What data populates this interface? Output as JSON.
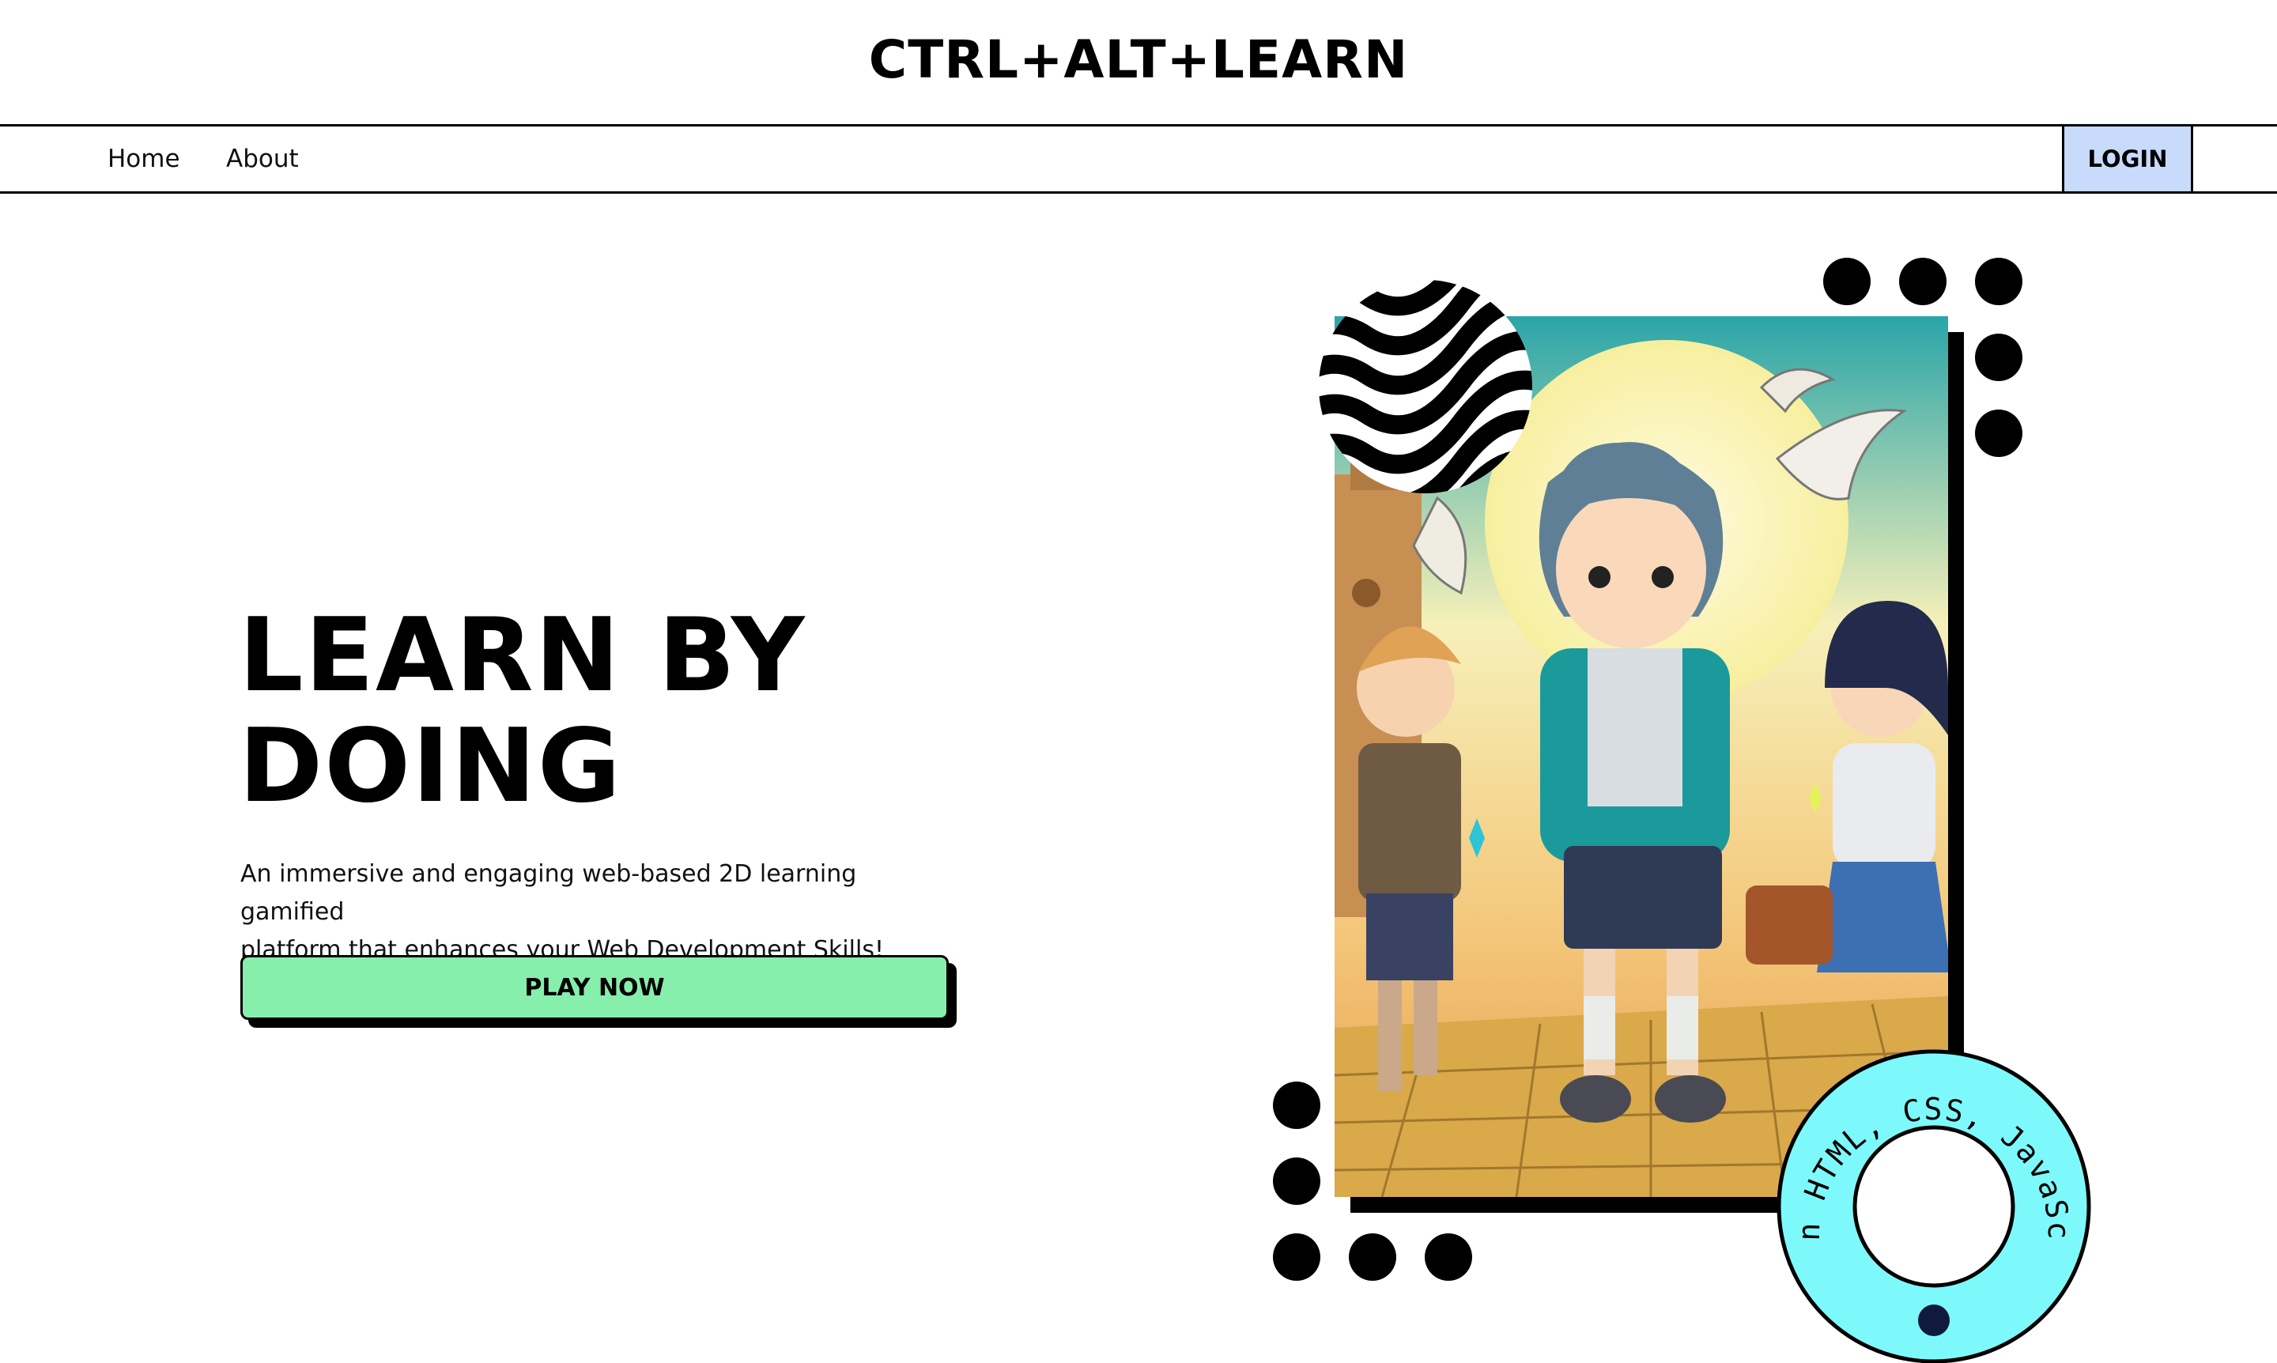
{
  "header": {
    "brand": "CTRL+ALT+LEARN"
  },
  "nav": {
    "home_label": "Home",
    "about_label": "About",
    "login_label": "LOGIN"
  },
  "hero": {
    "title_line1": "LEARN BY",
    "title_line2": "DOING",
    "description_line1": "An immersive and engaging web-based 2D learning gamified",
    "description_line2": "platform that enhances your Web Development Skills!",
    "cta_label": "PLAY NOW"
  },
  "badge": {
    "text": "Learn HTML, CSS, JavaScript"
  },
  "colors": {
    "login_bg": "#c8dbfa",
    "cta_bg": "#86efac",
    "badge_bg": "#7ef9fb",
    "accent_dark": "#0f1a3c"
  }
}
